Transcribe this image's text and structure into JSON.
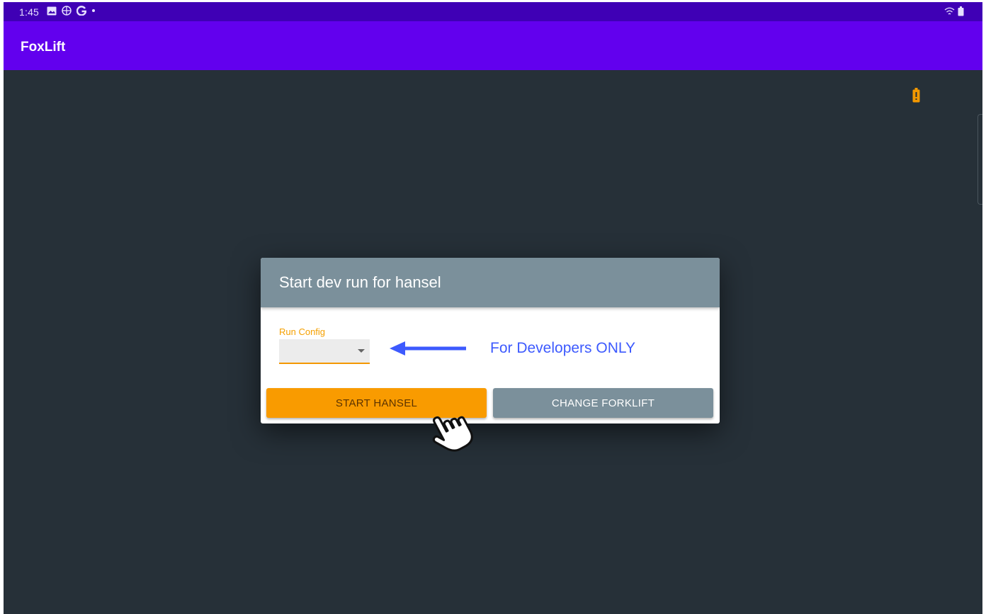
{
  "status_bar": {
    "time": "1:45",
    "icons": [
      "image-icon",
      "globe-icon",
      "google-icon",
      "dot-icon"
    ],
    "right_icons": [
      "wifi-icon",
      "battery-icon"
    ]
  },
  "app_bar": {
    "title": "FoxLift"
  },
  "indicators": {
    "battery_warning_color": "#f39800"
  },
  "dialog": {
    "title": "Start dev run for hansel",
    "run_config": {
      "label": "Run Config",
      "value": ""
    },
    "annotation": "For Developers ONLY",
    "buttons": {
      "start": "START HANSEL",
      "change": "CHANGE FORKLIFT"
    }
  },
  "colors": {
    "status_bar": "#3f00b5",
    "app_bar": "#6200ee",
    "background": "#263038",
    "accent_orange": "#f99b00",
    "dialog_header": "#7b909b",
    "annotation_blue": "#3d5afe"
  }
}
